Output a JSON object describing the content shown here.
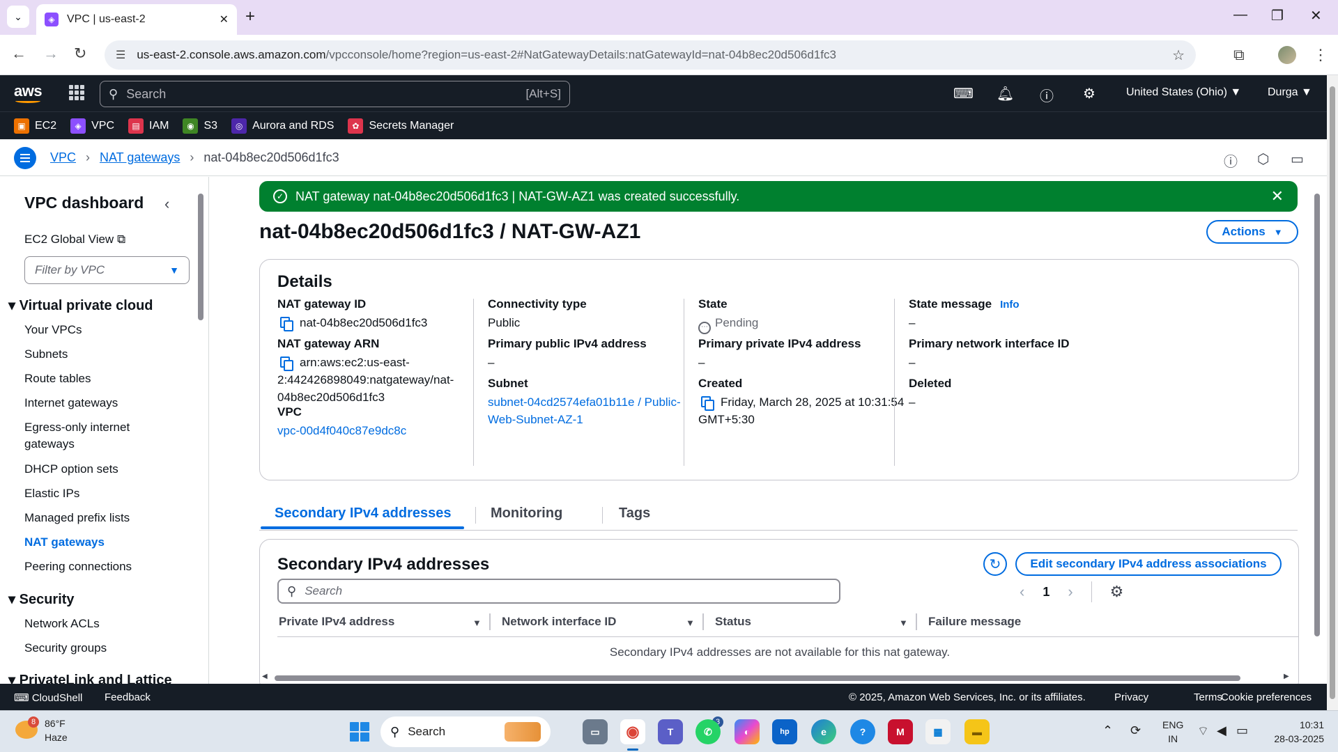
{
  "browser": {
    "tab_title": "VPC | us-east-2",
    "url_host": "us-east-2.console.aws.amazon.com",
    "url_path": "/vpcconsole/home?region=us-east-2#NatGatewayDetails:natGatewayId=nat-04b8ec20d506d1fc3"
  },
  "aws_nav": {
    "logo": "aws",
    "search_placeholder": "Search",
    "search_shortcut": "[Alt+S]",
    "region": "United States (Ohio) ▼",
    "user": "Durga ▼"
  },
  "favorites": [
    {
      "label": "EC2",
      "color": "#ed7100"
    },
    {
      "label": "VPC",
      "color": "#8c4fff"
    },
    {
      "label": "IAM",
      "color": "#dd344c"
    },
    {
      "label": "S3",
      "color": "#3f8624"
    },
    {
      "label": "Aurora and RDS",
      "color": "#4d27aa"
    },
    {
      "label": "Secrets Manager",
      "color": "#dd344c"
    }
  ],
  "breadcrumb": {
    "items": [
      "VPC",
      "NAT gateways"
    ],
    "current": "nat-04b8ec20d506d1fc3"
  },
  "sidebar": {
    "title": "VPC dashboard",
    "ec2_global_view": "EC2 Global View",
    "filter_placeholder": "Filter by VPC",
    "section_vpc": "Virtual private cloud",
    "vpc_items": [
      "Your VPCs",
      "Subnets",
      "Route tables",
      "Internet gateways",
      "Egress-only internet",
      "gateways",
      "DHCP option sets",
      "Elastic IPs",
      "Managed prefix lists",
      "NAT gateways",
      "Peering connections"
    ],
    "section_security": "Security",
    "security_items": [
      "Network ACLs",
      "Security groups"
    ],
    "section_privatelink": "PrivateLink and Lattice"
  },
  "flash": {
    "message": "NAT gateway nat-04b8ec20d506d1fc3 | NAT-GW-AZ1 was created successfully."
  },
  "page": {
    "title": "nat-04b8ec20d506d1fc3 / NAT-GW-AZ1",
    "actions_label": "Actions"
  },
  "details": {
    "heading": "Details",
    "nat_gateway_id_label": "NAT gateway ID",
    "nat_gateway_id": "nat-04b8ec20d506d1fc3",
    "nat_gateway_arn_label": "NAT gateway ARN",
    "nat_gateway_arn_1": "arn:aws:ec2:us-east-",
    "nat_gateway_arn_2": "2:442426898049:natgateway/nat-",
    "nat_gateway_arn_3": "04b8ec20d506d1fc3",
    "vpc_label": "VPC",
    "vpc": "vpc-00d4f040c87e9dc8c",
    "connectivity_type_label": "Connectivity type",
    "connectivity_type": "Public",
    "primary_public_ip_label": "Primary public IPv4 address",
    "primary_public_ip": "–",
    "subnet_label": "Subnet",
    "subnet_1": "subnet-04cd2574efa01b11e / Public-",
    "subnet_2": "Web-Subnet-AZ-1",
    "state_label": "State",
    "state": "Pending",
    "primary_private_ip_label": "Primary private IPv4 address",
    "primary_private_ip": "–",
    "created_label": "Created",
    "created_1": "Friday, March 28, 2025 at 10:31:54",
    "created_2": "GMT+5:30",
    "state_message_label": "State message",
    "info": "Info",
    "state_message": "–",
    "primary_eni_label": "Primary network interface ID",
    "primary_eni": "–",
    "deleted_label": "Deleted",
    "deleted": "–"
  },
  "tabs": [
    "Secondary IPv4 addresses",
    "Monitoring",
    "Tags"
  ],
  "secondary": {
    "heading": "Secondary IPv4 addresses",
    "edit_button": "Edit secondary IPv4 address associations",
    "search_placeholder": "Search",
    "page_number": "1",
    "columns": [
      "Private IPv4 address",
      "Network interface ID",
      "Status",
      "Failure message"
    ],
    "empty_message": "Secondary IPv4 addresses are not available for this nat gateway."
  },
  "footer": {
    "cloudshell": "CloudShell",
    "feedback": "Feedback",
    "copyright": "© 2025, Amazon Web Services, Inc. or its affiliates.",
    "privacy": "Privacy",
    "terms": "Terms",
    "cookies": "Cookie preferences"
  },
  "taskbar": {
    "temp": "86°F",
    "weather": "Haze",
    "weather_badge": "8",
    "search": "Search",
    "teams_badge": "3",
    "lang_1": "ENG",
    "lang_2": "IN",
    "time": "10:31",
    "date": "28-03-2025"
  }
}
